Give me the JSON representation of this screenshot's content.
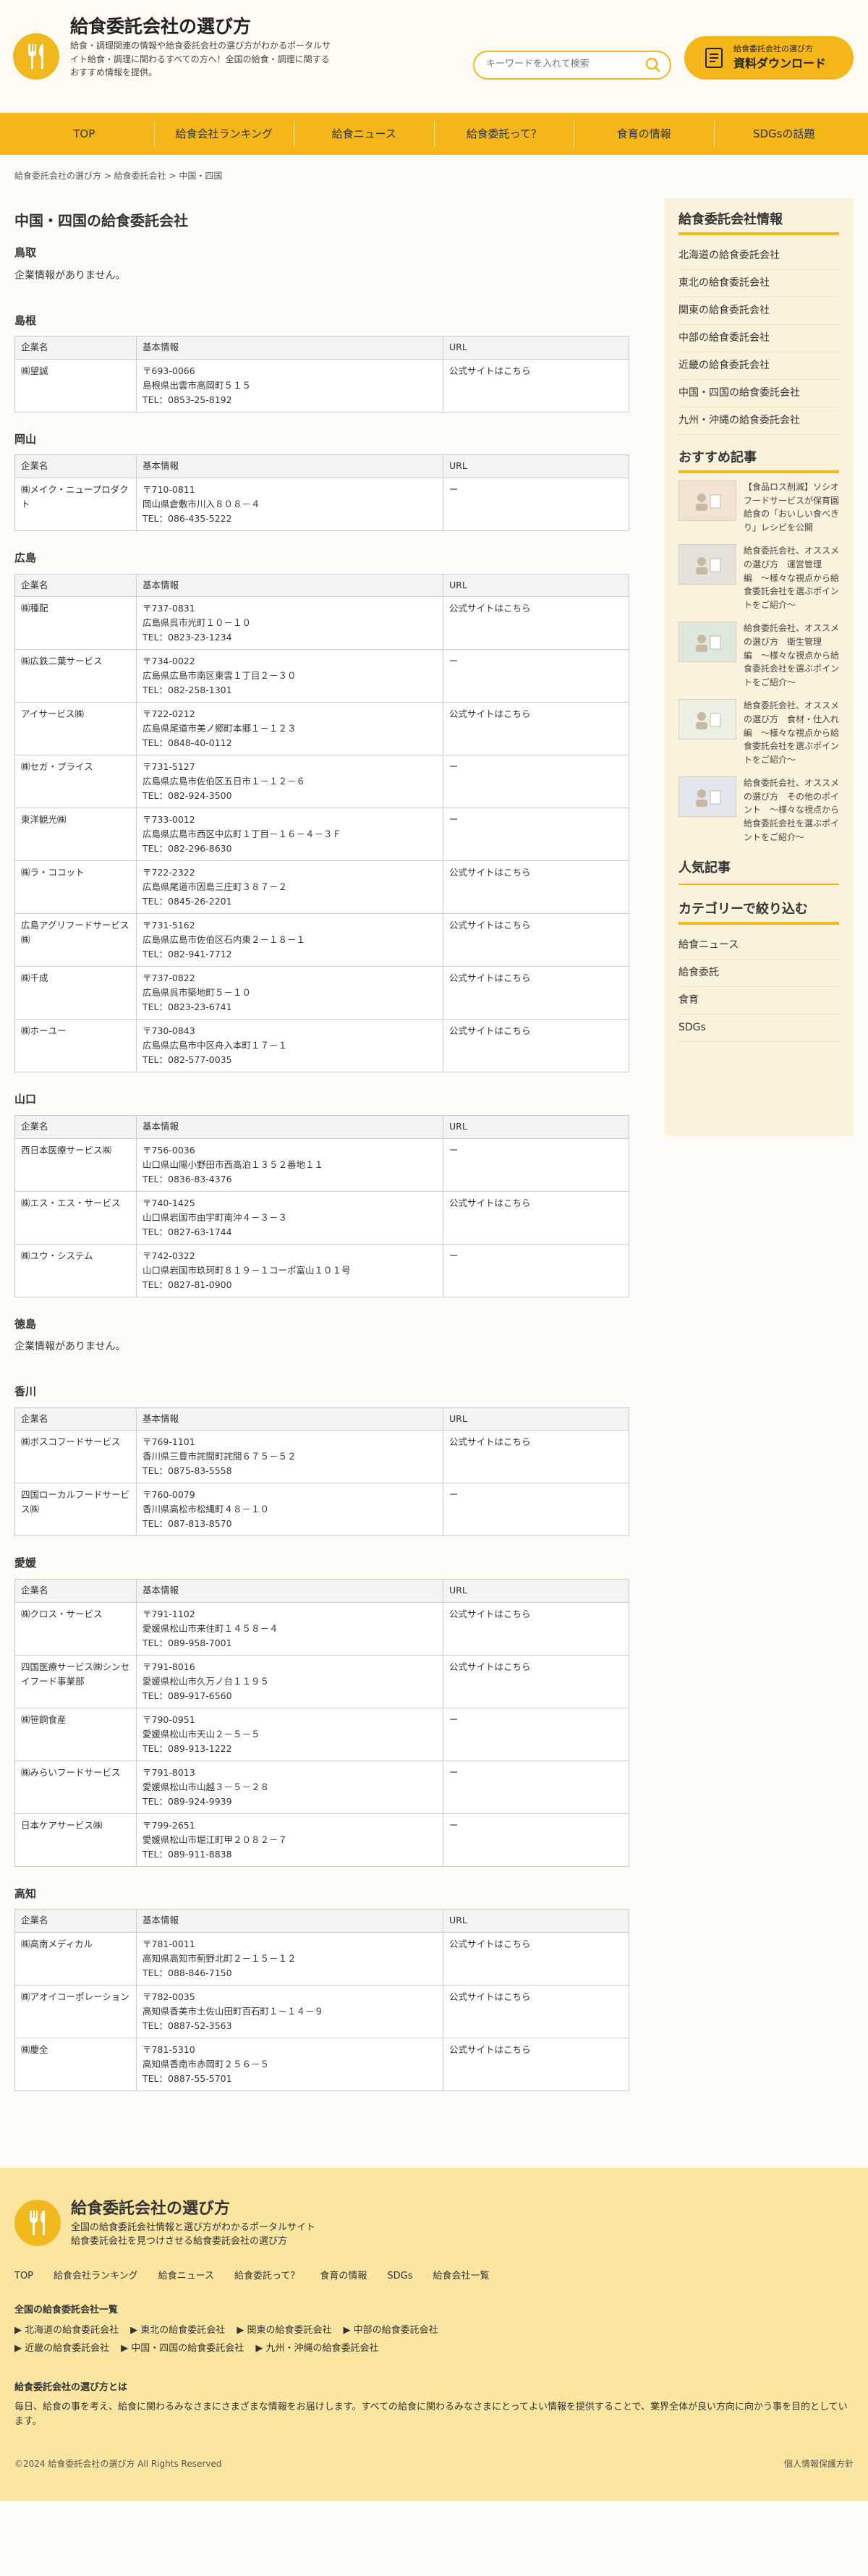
{
  "header": {
    "title": "給食委託会社の選び方",
    "desc": "給食・調理関連の情報や給食委託会社の選び方がわかるポータルサイト給食・調理に関わるすべての方へ！全国の給食・調理に関するおすすめ情報を提供。",
    "search_placeholder": "キーワードを入れて検索",
    "dl_small": "給食委託会社の選び方",
    "dl_big": "資料ダウンロード"
  },
  "nav": [
    "TOP",
    "給食会社ランキング",
    "給食ニュース",
    "給食委託って？",
    "食育の情報",
    "SDGsの話題"
  ],
  "breadcrumb": "給食委託会社の選び方 > 給食委託会社 > 中国・四国",
  "page_title": "中国・四国の給食委託会社",
  "cols": {
    "name": "企業名",
    "info": "基本情報",
    "url": "URL"
  },
  "sections": {
    "tottori": {
      "name": "鳥取",
      "none": "企業情報がありません。"
    },
    "shimane": {
      "name": "島根",
      "rows": [
        {
          "n": "㈱望誠",
          "z": "〒693-0066",
          "a": "島根県出雲市高岡町５１５",
          "t": "TEL：0853-25-8192",
          "u": "公式サイトはこちら"
        }
      ]
    },
    "okayama": {
      "name": "岡山",
      "rows": [
        {
          "n": "㈱メイク・ニュープロダクト",
          "z": "〒710-0811",
          "a": "岡山県倉敷市川入８０８－４",
          "t": "TEL：086-435-5222",
          "u": "ー"
        }
      ]
    },
    "hiroshima": {
      "name": "広島",
      "rows": [
        {
          "n": "㈱種配",
          "z": "〒737-0831",
          "a": "広島県呉市光町１０－１０",
          "t": "TEL：0823-23-1234",
          "u": "公式サイトはこちら"
        },
        {
          "n": "㈱広鉄二葉サービス",
          "z": "〒734-0022",
          "a": "広島県広島市南区東雲１丁目２－３０",
          "t": "TEL：082-258-1301",
          "u": "ー"
        },
        {
          "n": "アイサービス㈱",
          "z": "〒722-0212",
          "a": "広島県尾道市美ノ郷町本郷１－１２３",
          "t": "TEL：0848-40-0112",
          "u": "公式サイトはこちら"
        },
        {
          "n": "㈱セガ・プライス",
          "z": "〒731-5127",
          "a": "広島県広島市佐伯区五日市１－１２－６",
          "t": "TEL：082-924-3500",
          "u": "ー"
        },
        {
          "n": "東洋観光㈱",
          "z": "〒733-0012",
          "a": "広島県広島市西区中広町１丁目－１６－４－３Ｆ",
          "t": "TEL：082-296-8630",
          "u": "ー"
        },
        {
          "n": "㈱ラ・ココット",
          "z": "〒722-2322",
          "a": "広島県尾道市因島三庄町３８７－２",
          "t": "TEL：0845-26-2201",
          "u": "公式サイトはこちら"
        },
        {
          "n": "広島アグリフードサービス㈱",
          "z": "〒731-5162",
          "a": "広島県広島市佐伯区石内東２－１８－１",
          "t": "TEL：082-941-7712",
          "u": "公式サイトはこちら"
        },
        {
          "n": "㈱千成",
          "z": "〒737-0822",
          "a": "広島県呉市築地町５－１０",
          "t": "TEL：0823-23-6741",
          "u": "公式サイトはこちら"
        },
        {
          "n": "㈱ホーユー",
          "z": "〒730-0843",
          "a": "広島県広島市中区舟入本町１７－１",
          "t": "TEL：082-577-0035",
          "u": "公式サイトはこちら"
        }
      ]
    },
    "yamaguchi": {
      "name": "山口",
      "rows": [
        {
          "n": "西日本医療サービス㈱",
          "z": "〒756-0036",
          "a": "山口県山陽小野田市西高泊１３５２番地１１",
          "t": "TEL：0836-83-4376",
          "u": "ー"
        },
        {
          "n": "㈱エス・エス・サービス",
          "z": "〒740-1425",
          "a": "山口県岩国市由宇町南沖４－３－３",
          "t": "TEL：0827-63-1744",
          "u": "公式サイトはこちら"
        },
        {
          "n": "㈱ユウ・システム",
          "z": "〒742-0322",
          "a": "山口県岩国市玖珂町８１９－１コーポ富山１０１号",
          "t": "TEL：0827-81-0900",
          "u": "ー"
        }
      ]
    },
    "tokushima": {
      "name": "徳島",
      "none": "企業情報がありません。"
    },
    "kagawa": {
      "name": "香川",
      "rows": [
        {
          "n": "㈱ボスコフードサービス",
          "z": "〒769-1101",
          "a": "香川県三豊市詫間町詫間６７５－５２",
          "t": "TEL：0875-83-5558",
          "u": "公式サイトはこちら"
        },
        {
          "n": "四国ローカルフードサービス㈱",
          "z": "〒760-0079",
          "a": "香川県高松市松縄町４８－１０",
          "t": "TEL：087-813-8570",
          "u": "ー"
        }
      ]
    },
    "ehime": {
      "name": "愛媛",
      "rows": [
        {
          "n": "㈱クロス・サービス",
          "z": "〒791-1102",
          "a": "愛媛県松山市来住町１４５８－４",
          "t": "TEL：089-958-7001",
          "u": "公式サイトはこちら"
        },
        {
          "n": "四国医療サービス㈱シンセイフード事業部",
          "z": "〒791-8016",
          "a": "愛媛県松山市久万ノ台１１９５",
          "t": "TEL：089-917-6560",
          "u": "公式サイトはこちら"
        },
        {
          "n": "㈱笹鋼食産",
          "z": "〒790-0951",
          "a": "愛媛県松山市天山２－５－５",
          "t": "TEL：089-913-1222",
          "u": "ー"
        },
        {
          "n": "㈱みらいフードサービス",
          "z": "〒791-8013",
          "a": "愛媛県松山市山越３－５－２８",
          "t": "TEL：089-924-9939",
          "u": "ー"
        },
        {
          "n": "日本ケアサービス㈱",
          "z": "〒799-2651",
          "a": "愛媛県松山市堀江町甲２０８２－７",
          "t": "TEL：089-911-8838",
          "u": "ー"
        }
      ]
    },
    "kochi": {
      "name": "高知",
      "rows": [
        {
          "n": "㈱高南メディカル",
          "z": "〒781-0011",
          "a": "高知県高知市薊野北町２－１５－１２",
          "t": "TEL：088-846-7150",
          "u": "公式サイトはこちら"
        },
        {
          "n": "㈱アオイコーポレーション",
          "z": "〒782-0035",
          "a": "高知県香美市土佐山田町百石町１－１４－９",
          "t": "TEL：0887-52-3563",
          "u": "公式サイトはこちら"
        },
        {
          "n": "㈱慶全",
          "z": "〒781-5310",
          "a": "高知県香南市赤岡町２５６－５",
          "t": "TEL：0887-55-5701",
          "u": "公式サイトはこちら"
        }
      ]
    }
  },
  "sidebar": {
    "h1": "給食委託会社情報",
    "regions": [
      "北海道の給食委託会社",
      "東北の給食委託会社",
      "関東の給食委託会社",
      "中部の給食委託会社",
      "近畿の給食委託会社",
      "中国・四国の給食委託会社",
      "九州・沖縄の給食委託会社"
    ],
    "h2": "おすすめ記事",
    "articles": [
      "【食品ロス削減】ソシオフードサービスが保育園給食の「おいしい食べきり」レシピを公開",
      "給食委託会社、オススメの選び方　運営管理編　〜様々な視点から給食委託会社を選ぶポイントをご紹介〜",
      "給食委託会社、オススメの選び方　衛生管理編　〜様々な視点から給食委託会社を選ぶポイントをご紹介〜",
      "給食委託会社、オススメの選び方　食材・仕入れ編　〜様々な視点から給食委託会社を選ぶポイントをご紹介〜",
      "給食委託会社、オススメの選び方　その他のポイント　〜様々な視点から給食委託会社を選ぶポイントをご紹介〜"
    ],
    "h3": "人気記事",
    "h4": "カテゴリーで絞り込む",
    "cats": [
      "給食ニュース",
      "給食委託",
      "食育",
      "SDGs"
    ]
  },
  "footer": {
    "title": "給食委託会社の選び方",
    "desc1": "全国の給食委託会社情報と選び方がわかるポータルサイト",
    "desc2": "給食委託会社を見つけさせる給食委託会社の選び方",
    "nav": [
      "TOP",
      "給食会社ランキング",
      "給食ニュース",
      "給食委託って？",
      "食育の情報",
      "SDGs",
      "給食会社一覧"
    ],
    "list_h": "全国の給食委託会社一覧",
    "links": [
      "北海道の給食委託会社",
      "東北の給食委託会社",
      "関東の給食委託会社",
      "中部の給食委託会社",
      "近畿の給食委託会社",
      "中国・四国の給食委託会社",
      "九州・沖縄の給食委託会社"
    ],
    "about_h": "給食委託会社の選び方とは",
    "about": "毎日、給食の事を考え、給食に関わるみなさまにさまざまな情報をお届けします。すべての給食に関わるみなさまにとってよい情報を提供することで、業界全体が良い方向に向かう事を目的としています。",
    "copy": "©2024 給食委託会社の選び方 All Rights Reserved",
    "privacy": "個人情報保護方針"
  }
}
